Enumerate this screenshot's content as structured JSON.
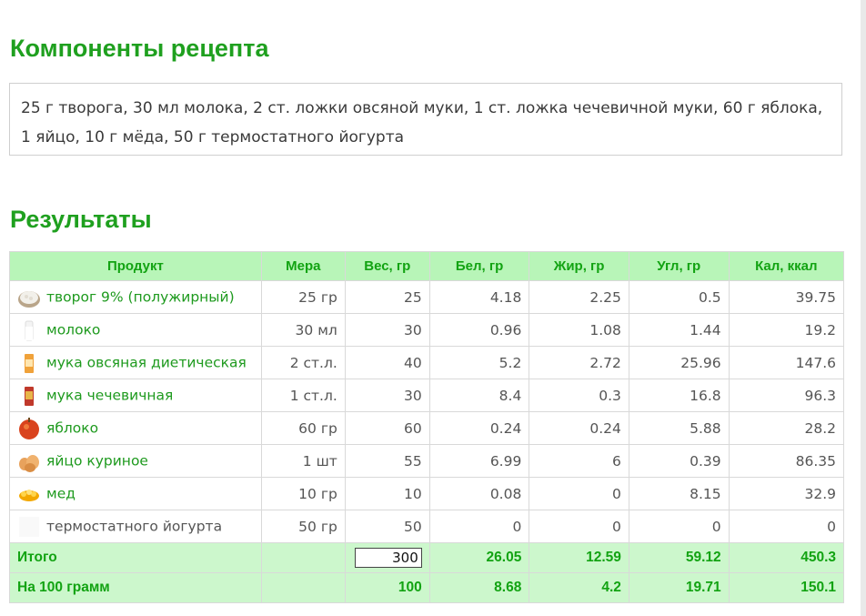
{
  "components": {
    "heading": "Компоненты рецепта",
    "text": "25 г творога, 30 мл молока, 2 ст. ложки овсяной муки, 1 ст. ложка чечевичной муки, 60 г яблока, 1 яйцо, 10 г мёда, 50 г термостатного йогурта"
  },
  "results": {
    "heading": "Результаты",
    "columns": [
      "Продукт",
      "Мера",
      "Вес, гр",
      "Бел, гр",
      "Жир, гр",
      "Угл, гр",
      "Кал, ккал"
    ],
    "rows": [
      {
        "icon": "cottage-cheese-icon",
        "name": "творог 9% (полужирный)",
        "measure": "25 гр",
        "weight": "25",
        "protein": "4.18",
        "fat": "2.25",
        "carbs": "0.5",
        "kcal": "39.75"
      },
      {
        "icon": "milk-icon",
        "name": "молоко",
        "measure": "30 мл",
        "weight": "30",
        "protein": "0.96",
        "fat": "1.08",
        "carbs": "1.44",
        "kcal": "19.2"
      },
      {
        "icon": "oat-flour-icon",
        "name": "мука овсяная диетическая",
        "measure": "2 ст.л.",
        "weight": "40",
        "protein": "5.2",
        "fat": "2.72",
        "carbs": "25.96",
        "kcal": "147.6"
      },
      {
        "icon": "lentil-flour-icon",
        "name": "мука чечевичная",
        "measure": "1 ст.л.",
        "weight": "30",
        "protein": "8.4",
        "fat": "0.3",
        "carbs": "16.8",
        "kcal": "96.3"
      },
      {
        "icon": "apple-icon",
        "name": "яблоко",
        "measure": "60 гр",
        "weight": "60",
        "protein": "0.24",
        "fat": "0.24",
        "carbs": "5.88",
        "kcal": "28.2"
      },
      {
        "icon": "eggs-icon",
        "name": "яйцо куриное",
        "measure": "1 шт",
        "weight": "55",
        "protein": "6.99",
        "fat": "6",
        "carbs": "0.39",
        "kcal": "86.35"
      },
      {
        "icon": "honey-icon",
        "name": "мед",
        "measure": "10 гр",
        "weight": "10",
        "protein": "0.08",
        "fat": "0",
        "carbs": "8.15",
        "kcal": "32.9"
      },
      {
        "icon": "blank-icon",
        "name": "термостатного йогурта",
        "measure": "50 гр",
        "weight": "50",
        "protein": "0",
        "fat": "0",
        "carbs": "0",
        "kcal": "0"
      }
    ],
    "total": {
      "label": "Итого",
      "weight": "300",
      "protein": "26.05",
      "fat": "12.59",
      "carbs": "59.12",
      "kcal": "450.3"
    },
    "per100": {
      "label": "На 100 грамм",
      "weight": "100",
      "protein": "8.68",
      "fat": "4.2",
      "carbs": "19.71",
      "kcal": "150.1"
    }
  },
  "colors": {
    "accent": "#1fa01f",
    "header_bg": "#b8f5b8",
    "summary_bg": "#ccf7cc"
  }
}
